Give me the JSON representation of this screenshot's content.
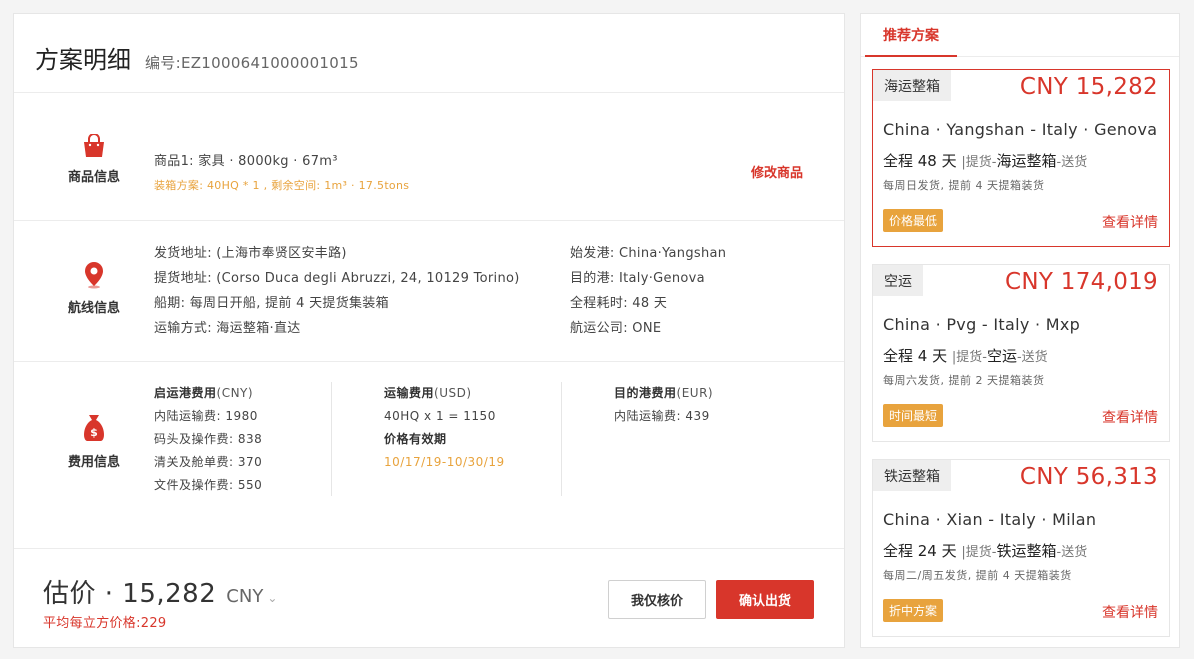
{
  "plan": {
    "title": "方案明细",
    "code": "编号:EZ1000641000001015"
  },
  "goods": {
    "label": "商品信息",
    "line1": "商品1:  家具 · 8000kg · 67m³",
    "line2": "装箱方案: 40HQ * 1 , 剩余空间: 1m³ · 17.5tons",
    "edit_label": "修改商品"
  },
  "route": {
    "label": "航线信息",
    "left": [
      "发货地址: (上海市奉贤区安丰路)",
      "提货地址: (Corso Duca degli Abruzzi, 24, 10129 Torino)",
      "船期: 每周日开船, 提前 4 天提货集装箱",
      "运输方式: 海运整箱·直达"
    ],
    "right": [
      "始发港: China·Yangshan",
      "目的港: Italy·Genova",
      "全程耗时: 48 天",
      "航运公司: ONE"
    ]
  },
  "fees": {
    "label": "费用信息",
    "origin": {
      "title": "启运港费用",
      "currency": "(CNY)",
      "items": [
        "内陆运输费: 1980",
        "码头及操作费: 838",
        "清关及舱单费: 370",
        "文件及操作费: 550"
      ]
    },
    "transport": {
      "title": "运输费用",
      "currency": "(USD)",
      "line": "40HQ x 1 = 1150",
      "validity_title": "价格有效期",
      "validity": "10/17/19-10/30/19"
    },
    "destination": {
      "title": "目的港费用",
      "currency": "(EUR)",
      "items": [
        "内陆运输费: 439"
      ]
    }
  },
  "footer": {
    "estimate": "估价 · 15,282",
    "currency": "CNY",
    "avg": "平均每立方价格:229",
    "check_label": "我仅核价",
    "confirm_label": "确认出货"
  },
  "sidebar": {
    "tab": "推荐方案",
    "cards": [
      {
        "mode": "海运整箱",
        "price": "CNY 15,282",
        "route": "China · Yangshan - Italy · Genova",
        "dur_prefix": "全程 48 天",
        "dur_mid": "|提货-",
        "dur_strong": "海运整箱",
        "dur_end": "-送货",
        "note": "每周日发货,  提前 4 天提箱装货",
        "badge": "价格最低",
        "detail": "查看详情"
      },
      {
        "mode": "空运",
        "price": "CNY 174,019",
        "route": "China · Pvg - Italy · Mxp",
        "dur_prefix": "全程 4 天",
        "dur_mid": "|提货-",
        "dur_strong": "空运",
        "dur_end": "-送货",
        "note": "每周六发货,  提前 2 天提箱装货",
        "badge": "时间最短",
        "detail": "查看详情"
      },
      {
        "mode": "铁运整箱",
        "price": "CNY 56,313",
        "route": "China · Xian - Italy · Milan",
        "dur_prefix": "全程 24 天",
        "dur_mid": "|提货-",
        "dur_strong": "铁运整箱",
        "dur_end": "-送货",
        "note": "每周二/周五发货,  提前 4 天提箱装货",
        "badge": "折中方案",
        "detail": "查看详情"
      }
    ]
  },
  "colors": {
    "accent": "#d8362b",
    "warning": "#e8a33d"
  }
}
